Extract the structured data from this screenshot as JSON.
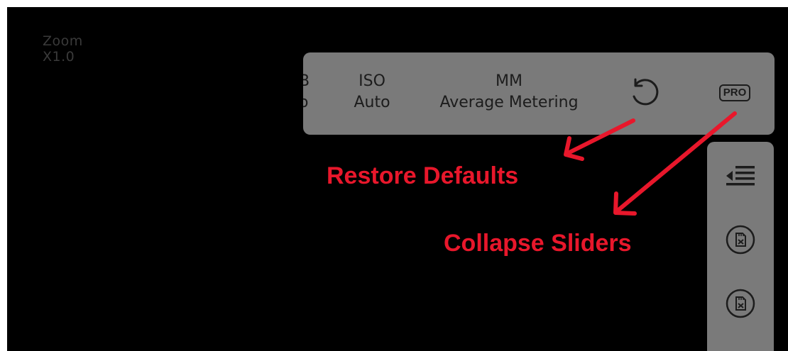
{
  "zoom": {
    "label": "Zoom",
    "value": "X1.0"
  },
  "top_panel": {
    "partial_param": {
      "label": "B",
      "value": "o"
    },
    "iso": {
      "label": "ISO",
      "value": "Auto"
    },
    "metering": {
      "label": "MM",
      "value": "Average Metering"
    },
    "restore_icon": "restore-rotate-icon",
    "pro_label": "PRO"
  },
  "side_panel": {
    "collapse_icon": "collapse-sliders-icon",
    "card_icon": "sd-card-x-icon"
  },
  "annotations": {
    "restore_defaults": "Restore Defaults",
    "collapse_sliders": "Collapse Sliders"
  },
  "colors": {
    "background": "#000000",
    "panel": "#7a7a7a",
    "panel_text": "#1c1c1c",
    "annotation": "#e8172b",
    "dim_text": "#3a3a3a"
  }
}
